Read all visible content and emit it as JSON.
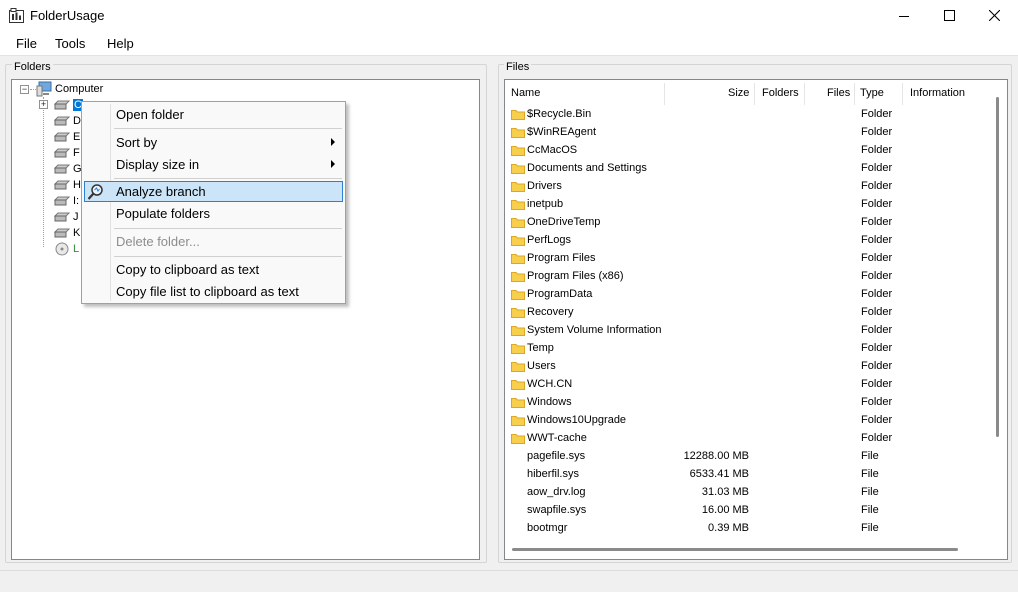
{
  "window": {
    "title": "FolderUsage"
  },
  "menu": [
    "File",
    "Tools",
    "Help"
  ],
  "folders_panel": {
    "label": "Folders",
    "root": "Computer",
    "drives": [
      "C",
      "D",
      "E",
      "F",
      "G",
      "H",
      "I:",
      "J",
      "K",
      "L"
    ]
  },
  "context_menu": {
    "items": [
      {
        "label": "Open folder"
      },
      {
        "label": "Sort by"
      },
      {
        "label": "Display size in"
      },
      {
        "label": "Analyze branch"
      },
      {
        "label": "Populate folders"
      },
      {
        "label": "Delete folder..."
      },
      {
        "label": "Copy to clipboard as text"
      },
      {
        "label": "Copy file list to clipboard as text"
      }
    ]
  },
  "files_panel": {
    "label": "Files",
    "columns": [
      "Name",
      "Size",
      "Folders",
      "Files",
      "Type",
      "Information"
    ],
    "rows": [
      {
        "name": "$Recycle.Bin",
        "size": "",
        "type": "Folder",
        "icon": "folder-icon"
      },
      {
        "name": "$WinREAgent",
        "size": "",
        "type": "Folder",
        "icon": "folder-icon"
      },
      {
        "name": "CcMacOS",
        "size": "",
        "type": "Folder",
        "icon": "folder-icon"
      },
      {
        "name": "Documents and Settings",
        "size": "",
        "type": "Folder",
        "icon": "folder-icon"
      },
      {
        "name": "Drivers",
        "size": "",
        "type": "Folder",
        "icon": "folder-icon"
      },
      {
        "name": "inetpub",
        "size": "",
        "type": "Folder",
        "icon": "folder-icon"
      },
      {
        "name": "OneDriveTemp",
        "size": "",
        "type": "Folder",
        "icon": "folder-icon"
      },
      {
        "name": "PerfLogs",
        "size": "",
        "type": "Folder",
        "icon": "folder-icon"
      },
      {
        "name": "Program Files",
        "size": "",
        "type": "Folder",
        "icon": "folder-icon"
      },
      {
        "name": "Program Files (x86)",
        "size": "",
        "type": "Folder",
        "icon": "folder-icon"
      },
      {
        "name": "ProgramData",
        "size": "",
        "type": "Folder",
        "icon": "folder-icon"
      },
      {
        "name": "Recovery",
        "size": "",
        "type": "Folder",
        "icon": "folder-icon"
      },
      {
        "name": "System Volume Information",
        "size": "",
        "type": "Folder",
        "icon": "folder-icon"
      },
      {
        "name": "Temp",
        "size": "",
        "type": "Folder",
        "icon": "folder-icon"
      },
      {
        "name": "Users",
        "size": "",
        "type": "Folder",
        "icon": "folder-icon"
      },
      {
        "name": "WCH.CN",
        "size": "",
        "type": "Folder",
        "icon": "folder-icon"
      },
      {
        "name": "Windows",
        "size": "",
        "type": "Folder",
        "icon": "folder-icon"
      },
      {
        "name": "Windows10Upgrade",
        "size": "",
        "type": "Folder",
        "icon": "folder-icon"
      },
      {
        "name": "WWT-cache",
        "size": "",
        "type": "Folder",
        "icon": "folder-icon"
      },
      {
        "name": "pagefile.sys",
        "size": "12288.00 MB",
        "type": "File",
        "icon": ""
      },
      {
        "name": "hiberfil.sys",
        "size": "6533.41 MB",
        "type": "File",
        "icon": ""
      },
      {
        "name": "aow_drv.log",
        "size": "31.03 MB",
        "type": "File",
        "icon": ""
      },
      {
        "name": "swapfile.sys",
        "size": "16.00 MB",
        "type": "File",
        "icon": ""
      },
      {
        "name": "bootmgr",
        "size": "0.39 MB",
        "type": "File",
        "icon": ""
      }
    ]
  },
  "colors": {
    "selection": "#cce4f7",
    "selection_border": "#2d7fcf",
    "folder": "#f7cf4d"
  }
}
